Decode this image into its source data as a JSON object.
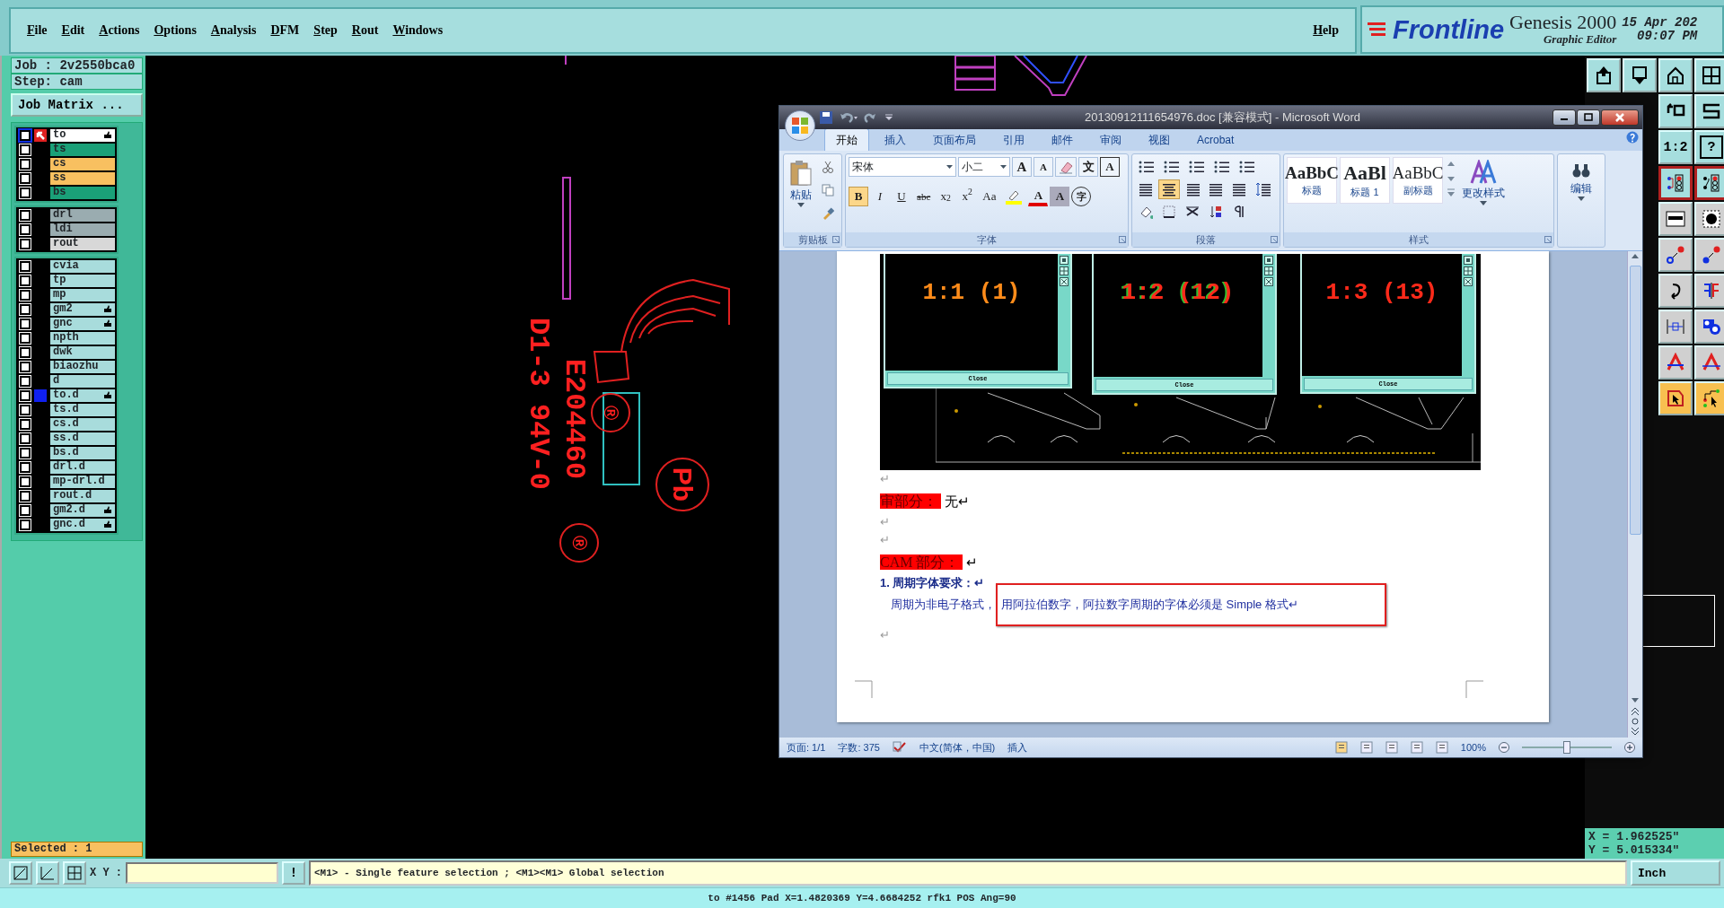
{
  "menu": {
    "items": [
      "File",
      "Edit",
      "Actions",
      "Options",
      "Analysis",
      "DFM",
      "Step",
      "Rout",
      "Windows"
    ],
    "help": "Help"
  },
  "brand": {
    "logo": "Frontline",
    "product": "Genesis 2000",
    "subtitle": "Graphic Editor",
    "date": "15 Apr 202",
    "time": "09:07 PM"
  },
  "job": {
    "job": "Job : 2v2550bca0",
    "step": "Step: cam",
    "matrix_button": "Job Matrix ..."
  },
  "layer_groups": [
    {
      "layers": [
        {
          "name": "to",
          "color": "#ffffff",
          "checked": false,
          "work": true,
          "tagged": false,
          "hand": true
        },
        {
          "name": "ts",
          "color": "#1aa078",
          "checked": false,
          "work": false,
          "tagged": false,
          "hand": false
        },
        {
          "name": "cs",
          "color": "#f8c060",
          "checked": false,
          "work": false,
          "tagged": false,
          "hand": false
        },
        {
          "name": "ss",
          "color": "#f8c060",
          "checked": false,
          "work": false,
          "tagged": false,
          "hand": false
        },
        {
          "name": "bs",
          "color": "#1aa078",
          "checked": false,
          "work": false,
          "tagged": false,
          "hand": false
        }
      ]
    },
    {
      "layers": [
        {
          "name": "drl",
          "color": "#9aacb0",
          "checked": false,
          "work": false,
          "tagged": false,
          "hand": false
        },
        {
          "name": "ldi",
          "color": "#9aacb0",
          "checked": false,
          "work": false,
          "tagged": false,
          "hand": false
        },
        {
          "name": "rout",
          "color": "#d8d8d8",
          "checked": false,
          "work": false,
          "tagged": false,
          "hand": false
        }
      ]
    },
    {
      "layers": [
        {
          "name": "cvia",
          "color": "#a8dcdc",
          "checked": false,
          "work": false,
          "tagged": false,
          "hand": false
        },
        {
          "name": "tp",
          "color": "#a8dcdc",
          "checked": false,
          "work": false,
          "tagged": false,
          "hand": false
        },
        {
          "name": "mp",
          "color": "#a8dcdc",
          "checked": false,
          "work": false,
          "tagged": false,
          "hand": false
        },
        {
          "name": "gm2",
          "color": "#a8dcdc",
          "checked": false,
          "work": false,
          "tagged": false,
          "hand": true
        },
        {
          "name": "gnc",
          "color": "#a8dcdc",
          "checked": false,
          "work": false,
          "tagged": false,
          "hand": true
        },
        {
          "name": "npth",
          "color": "#a8dcdc",
          "checked": false,
          "work": false,
          "tagged": false,
          "hand": false
        },
        {
          "name": "dwk",
          "color": "#a8dcdc",
          "checked": false,
          "work": false,
          "tagged": false,
          "hand": false
        },
        {
          "name": "biaozhu",
          "color": "#a8dcdc",
          "checked": false,
          "work": false,
          "tagged": false,
          "hand": false
        },
        {
          "name": "d",
          "color": "#a8dcdc",
          "checked": false,
          "work": false,
          "tagged": false,
          "hand": false
        },
        {
          "name": "to.d",
          "color": "#a8dcdc",
          "checked": false,
          "work": false,
          "tagged": true,
          "hand": true
        },
        {
          "name": "ts.d",
          "color": "#a8dcdc",
          "checked": false,
          "work": false,
          "tagged": false,
          "hand": false
        },
        {
          "name": "cs.d",
          "color": "#a8dcdc",
          "checked": false,
          "work": false,
          "tagged": false,
          "hand": false
        },
        {
          "name": "ss.d",
          "color": "#a8dcdc",
          "checked": false,
          "work": false,
          "tagged": false,
          "hand": false
        },
        {
          "name": "bs.d",
          "color": "#a8dcdc",
          "checked": false,
          "work": false,
          "tagged": false,
          "hand": false
        },
        {
          "name": "drl.d",
          "color": "#a8dcdc",
          "checked": false,
          "work": false,
          "tagged": false,
          "hand": false
        },
        {
          "name": "mp-drl.d",
          "color": "#a8dcdc",
          "checked": false,
          "work": false,
          "tagged": false,
          "hand": false
        },
        {
          "name": "rout.d",
          "color": "#a8dcdc",
          "checked": false,
          "work": false,
          "tagged": false,
          "hand": false
        },
        {
          "name": "gm2.d",
          "color": "#a8dcdc",
          "checked": false,
          "work": false,
          "tagged": false,
          "hand": true
        },
        {
          "name": "gnc.d",
          "color": "#a8dcdc",
          "checked": false,
          "work": false,
          "tagged": false,
          "hand": true
        }
      ]
    }
  ],
  "selected_count": "Selected : 1",
  "canvas": {
    "texts": [
      "E204460",
      "D1-3 94V-0"
    ],
    "circle_marks": [
      "®",
      "Pb",
      "®"
    ]
  },
  "toolbar": {
    "labels": [
      "1:2",
      "?"
    ]
  },
  "readout": {
    "x": "X = 1.962525\"",
    "y": "Y = 5.015334\""
  },
  "command_bar": {
    "xy_label": "X Y :",
    "alert_button": "!",
    "message": "<M1> - Single feature selection ; <M1><M1> Global selection",
    "units": "Inch"
  },
  "status_line": "to #1456 Pad X=1.4820369 Y=4.6684252 rfk1 POS Ang=90",
  "word": {
    "title": "20130912111654976.doc [兼容模式] - Microsoft Word",
    "tabs": [
      {
        "label": "开始",
        "selected": true
      },
      {
        "label": "插入",
        "selected": false
      },
      {
        "label": "页面布局",
        "selected": false
      },
      {
        "label": "引用",
        "selected": false
      },
      {
        "label": "邮件",
        "selected": false
      },
      {
        "label": "审阅",
        "selected": false
      },
      {
        "label": "视图",
        "selected": false
      },
      {
        "label": "Acrobat",
        "selected": false
      }
    ],
    "clipboard": {
      "paste": "粘贴",
      "group": "剪贴板"
    },
    "font": {
      "name": "宋体",
      "size": "小二",
      "group": "字体",
      "row1": [
        {
          "text": "A"
        },
        {
          "text": "A"
        },
        {
          "text": "文"
        },
        {
          "text": "A"
        }
      ],
      "row2": [
        {
          "text": "B",
          "selected": true
        },
        {
          "text": "I",
          "selected": false
        },
        {
          "text": "U",
          "selected": false
        },
        {
          "text": "abc",
          "selected": false
        },
        {
          "text": "x$_{2}$",
          "selected": false
        },
        {
          "text": "x$^{2}$",
          "selected": false
        },
        {
          "text": "Aa",
          "selected": false
        }
      ],
      "row2_tail": [
        {
          "text": "A"
        },
        {
          "text": "A"
        },
        {
          "text": "字"
        }
      ]
    },
    "paragraph": {
      "group": "段落",
      "align": [
        {
          "selected": false
        },
        {
          "selected": true
        },
        {
          "selected": false
        },
        {
          "selected": false
        },
        {
          "selected": false
        }
      ]
    },
    "styles": {
      "group": "样式",
      "items": [
        {
          "sample": "AaBbC",
          "name": "标题"
        },
        {
          "sample": "AaBl",
          "name": "标题 1"
        },
        {
          "sample": "AaBbC",
          "name": "副标题"
        }
      ],
      "change": "更改样式"
    },
    "editing": {
      "label": "编辑"
    },
    "document": {
      "image_panels": [
        {
          "label": "1:1 (1)",
          "color": "#ff8c1a",
          "button": "Close"
        },
        {
          "label": "1:2 (12)",
          "color": "#ff2a1a",
          "button": "Close"
        },
        {
          "label": "1:3 (13)",
          "color": "#ff2a1a",
          "button": "Close"
        }
      ],
      "paragraphs": [
        {
          "kind": "mark",
          "text": "↵"
        },
        {
          "kind": "heading",
          "label": "审部分：",
          "text": "无↵"
        },
        {
          "kind": "mark",
          "text": "↵"
        },
        {
          "kind": "mark",
          "text": "↵"
        },
        {
          "kind": "heading",
          "label": "CAM 部分：",
          "text": "↵"
        },
        {
          "kind": "numbered",
          "text": "1. 周期字体要求：↵"
        },
        {
          "kind": "boxed",
          "text": "周期为非电子格式，",
          "boxed": "用阿拉伯数字，阿拉数字周期的字体必须是 Simple 格式↵"
        },
        {
          "kind": "mark",
          "text": "↵"
        }
      ]
    },
    "status": {
      "page": "页面: 1/1",
      "words": "字数: 375",
      "language": "中文(简体，中国)",
      "mode": "插入",
      "zoom": "100%"
    },
    "zoom_slider": {
      "level": 0.5
    }
  }
}
